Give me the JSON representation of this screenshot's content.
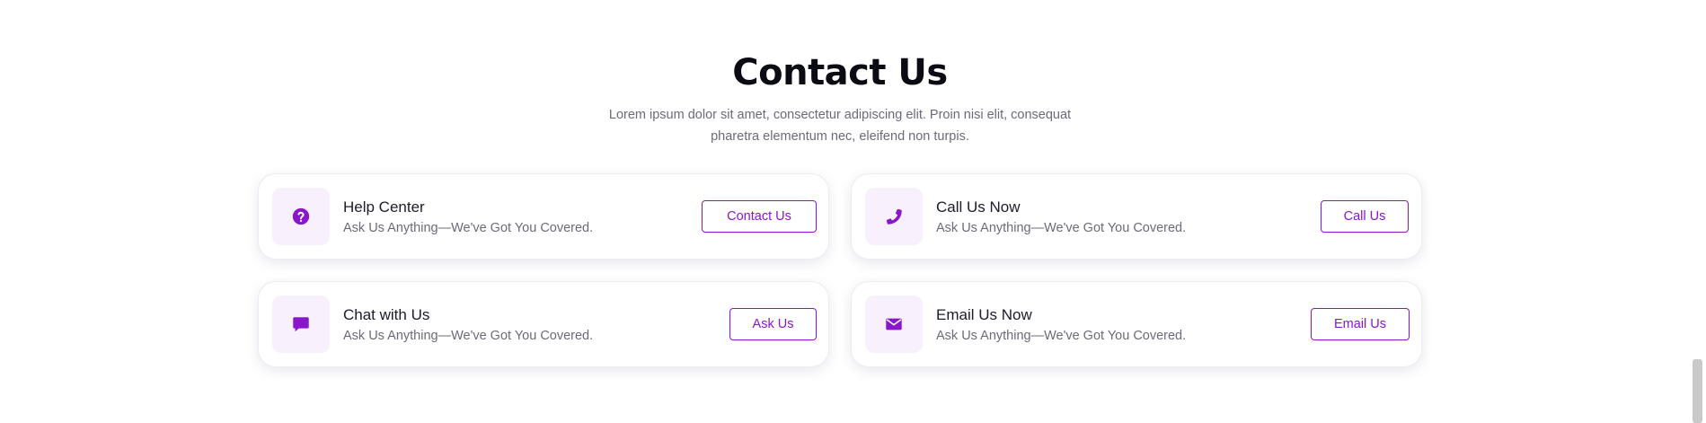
{
  "section": {
    "title": "Contact Us",
    "subtitle": "Lorem ipsum dolor sit amet, consectetur adipiscing elit. Proin nisi elit, consequat pharetra elementum nec, eleifend non turpis."
  },
  "cards": [
    {
      "icon": "question-circle-icon",
      "title": "Help Center",
      "description": "Ask Us Anything—We've Got You Covered.",
      "button_label": "Contact Us"
    },
    {
      "icon": "phone-icon",
      "title": "Call Us Now",
      "description": "Ask Us Anything—We've Got You Covered.",
      "button_label": "Call Us"
    },
    {
      "icon": "chat-icon",
      "title": "Chat with Us",
      "description": "Ask Us Anything—We've Got You Covered.",
      "button_label": "Ask Us"
    },
    {
      "icon": "envelope-icon",
      "title": "Email Us Now",
      "description": "Ask Us Anything—We've Got You Covered.",
      "button_label": "Email Us"
    }
  ],
  "colors": {
    "accent": "#8a16c9",
    "icon_background": "#f8f0fd",
    "title_text": "#0b0b14",
    "muted_text": "#6b6b78"
  }
}
